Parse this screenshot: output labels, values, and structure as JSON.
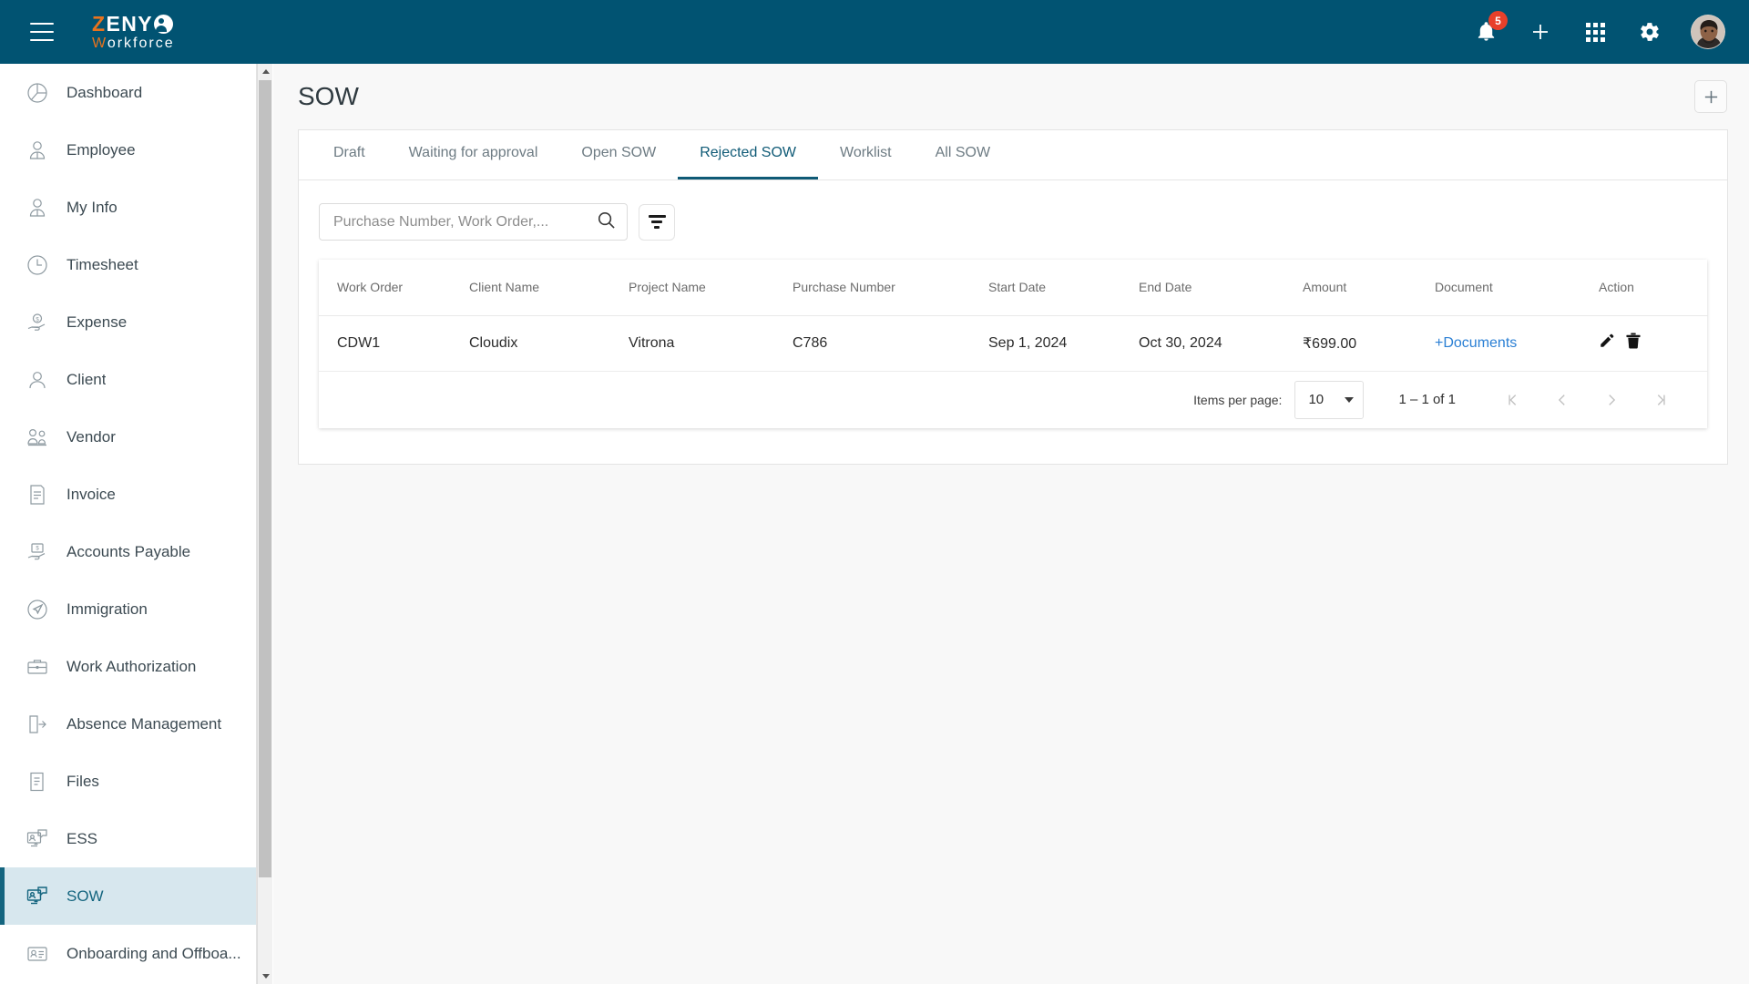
{
  "topbar": {
    "menu_icon": "hamburger-menu-icon",
    "logo": {
      "part1": "Z",
      "part2": "ENY",
      "part3": "W",
      "part4": "orkforce"
    },
    "notifications": {
      "icon": "bell-icon",
      "badge": "5"
    },
    "add": {
      "icon": "plus-icon"
    },
    "apps": {
      "icon": "grid-apps-icon"
    },
    "settings": {
      "icon": "gear-icon"
    },
    "avatar": {
      "icon": "user-avatar"
    }
  },
  "sidebar": {
    "items": [
      {
        "label": "Dashboard",
        "icon": "pie-chart-icon",
        "active": false
      },
      {
        "label": "Employee",
        "icon": "employee-icon",
        "active": false
      },
      {
        "label": "My Info",
        "icon": "my-info-icon",
        "active": false
      },
      {
        "label": "Timesheet",
        "icon": "clock-icon",
        "active": false
      },
      {
        "label": "Expense",
        "icon": "expense-hand-icon",
        "active": false
      },
      {
        "label": "Client",
        "icon": "person-icon",
        "active": false
      },
      {
        "label": "Vendor",
        "icon": "vendor-icon",
        "active": false
      },
      {
        "label": "Invoice",
        "icon": "invoice-icon",
        "active": false
      },
      {
        "label": "Accounts Payable",
        "icon": "accounts-payable-icon",
        "active": false
      },
      {
        "label": "Immigration",
        "icon": "airplane-globe-icon",
        "active": false
      },
      {
        "label": "Work Authorization",
        "icon": "briefcase-icon",
        "active": false
      },
      {
        "label": "Absence Management",
        "icon": "door-exit-icon",
        "active": false
      },
      {
        "label": "Files",
        "icon": "files-icon",
        "active": false
      },
      {
        "label": "ESS",
        "icon": "monitor-chat-icon",
        "active": false
      },
      {
        "label": "SOW",
        "icon": "monitor-chat-icon",
        "active": true
      },
      {
        "label": "Onboarding and Offboa...",
        "icon": "id-card-icon",
        "active": false
      }
    ]
  },
  "page": {
    "title": "SOW",
    "add_button_icon": "plus-icon"
  },
  "tabs": [
    {
      "label": "Draft",
      "active": false
    },
    {
      "label": "Waiting for approval",
      "active": false
    },
    {
      "label": "Open SOW",
      "active": false
    },
    {
      "label": "Rejected SOW",
      "active": true
    },
    {
      "label": "Worklist",
      "active": false
    },
    {
      "label": "All SOW",
      "active": false
    }
  ],
  "search": {
    "placeholder": "Purchase Number, Work Order,...",
    "value": "",
    "icon": "search-icon",
    "filter_icon": "filter-funnel-icon"
  },
  "table": {
    "columns": [
      "Work Order",
      "Client Name",
      "Project Name",
      "Purchase Number",
      "Start Date",
      "End Date",
      "Amount",
      "Document",
      "Action"
    ],
    "rows": [
      {
        "work_order": "CDW1",
        "client_name": "Cloudix",
        "project_name": "Vitrona",
        "purchase_number": "C786",
        "start_date": "Sep 1, 2024",
        "end_date": "Oct 30, 2024",
        "amount": "₹699.00",
        "document": "+Documents",
        "actions": {
          "edit_icon": "pencil-edit-icon",
          "delete_icon": "trash-delete-icon"
        }
      }
    ]
  },
  "paginator": {
    "items_per_page_label": "Items per page:",
    "items_per_page_value": "10",
    "range_label": "1 – 1 of 1",
    "first_icon": "first-page-icon",
    "prev_icon": "previous-page-icon",
    "next_icon": "next-page-icon",
    "last_icon": "last-page-icon"
  },
  "colors": {
    "brand_bar": "#015372",
    "brand_orange": "#e8731e",
    "active_tab": "#0f5a76",
    "active_nav_bg": "#d7e7ee",
    "link": "#2a7fd4",
    "badge": "#e8402a"
  }
}
